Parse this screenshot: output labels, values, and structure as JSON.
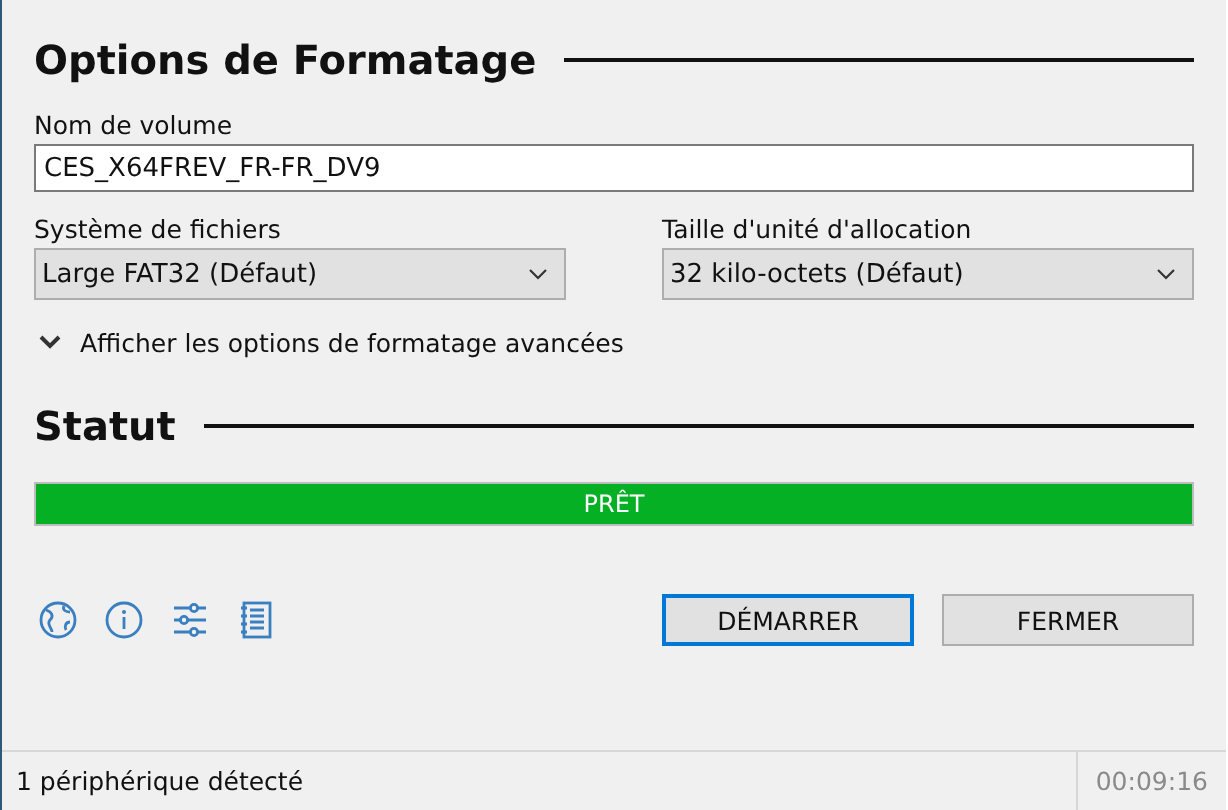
{
  "format_options": {
    "title": "Options de Formatage",
    "volume_label": {
      "label": "Nom de volume",
      "value": "CES_X64FREV_FR-FR_DV9"
    },
    "file_system": {
      "label": "Système de fichiers",
      "value": "Large FAT32 (Défaut)"
    },
    "cluster_size": {
      "label": "Taille d'unité d'allocation",
      "value": "32 kilo-octets (Défaut)"
    },
    "advanced": {
      "label": "Afficher les options de formatage avancées",
      "expanded": false
    }
  },
  "status": {
    "title": "Statut",
    "progress": {
      "level": 1,
      "text": "PRÊT"
    }
  },
  "toolbar_icons": [
    {
      "kind": "globe"
    },
    {
      "kind": "info"
    },
    {
      "kind": "settings"
    },
    {
      "kind": "log"
    }
  ],
  "buttons": [
    {
      "label": "DÉMARRER",
      "default": true
    },
    {
      "label": "FERMER",
      "default": false
    }
  ],
  "status_bar": {
    "text": "1 périphérique détecté",
    "time": "00:09:16"
  }
}
